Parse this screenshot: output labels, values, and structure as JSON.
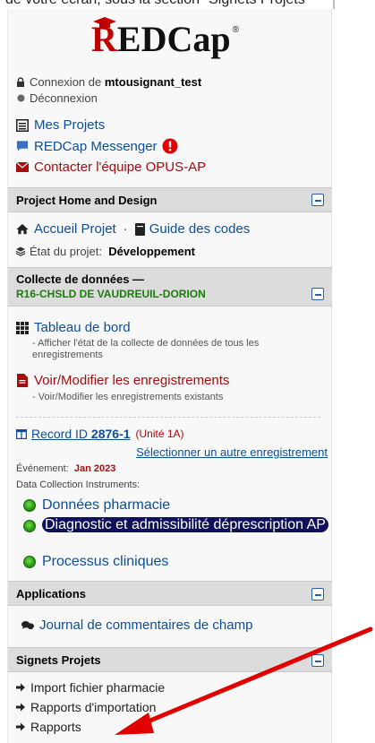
{
  "top_text": "de votre écran, sous la section \"Signets Projets\"",
  "logo": {
    "r": "R",
    "rest": "EDCap",
    "reg": "®"
  },
  "login": {
    "prefix": "Connexion de",
    "user": "mtousignant_test",
    "logout": "Déconnexion"
  },
  "top_links": {
    "my_projects": "Mes Projets",
    "messenger": "REDCap Messenger",
    "contact": "Contacter l'équipe OPUS-AP"
  },
  "project_home": {
    "header": "Project Home and Design",
    "home": "Accueil Projet",
    "separator": "·",
    "codebook": "Guide des codes",
    "status_label": "État du projet:",
    "status_value": "Développement"
  },
  "data_collection": {
    "header": "Collecte de données —",
    "site": "R16-CHSLD DE VAUDREUIL-DORION",
    "dashboard": "Tableau de bord",
    "dashboard_desc": "- Afficher l'état de la collecte de données de tous les enregistrements",
    "view_edit": "Voir/Modifier les enregistrements",
    "view_edit_desc": "- Voir/Modifier les enregistrements existants",
    "record_prefix": "Record ID",
    "record_id": "2876-1",
    "record_unit": "(Unité 1A)",
    "select_other": "Sélectionner un autre enregistrement",
    "event_label": "Événement:",
    "event_value": "Jan 2023",
    "instruments_label": "Data Collection Instruments:",
    "instruments": [
      "Données pharmacie",
      "Diagnostic et admissibilité déprescription AP",
      "Processus cliniques"
    ]
  },
  "applications": {
    "header": "Applications",
    "field_comments": "Journal de commentaires de champ"
  },
  "bookmarks": {
    "header": "Signets Projets",
    "items": [
      "Import fichier pharmacie",
      "Rapports d'importation",
      "Rapports"
    ]
  },
  "colors": {
    "brand_red": "#c00000",
    "link_blue": "#0b4f9a",
    "site_green": "#1d7a0f",
    "arrow_red": "#e00000"
  }
}
